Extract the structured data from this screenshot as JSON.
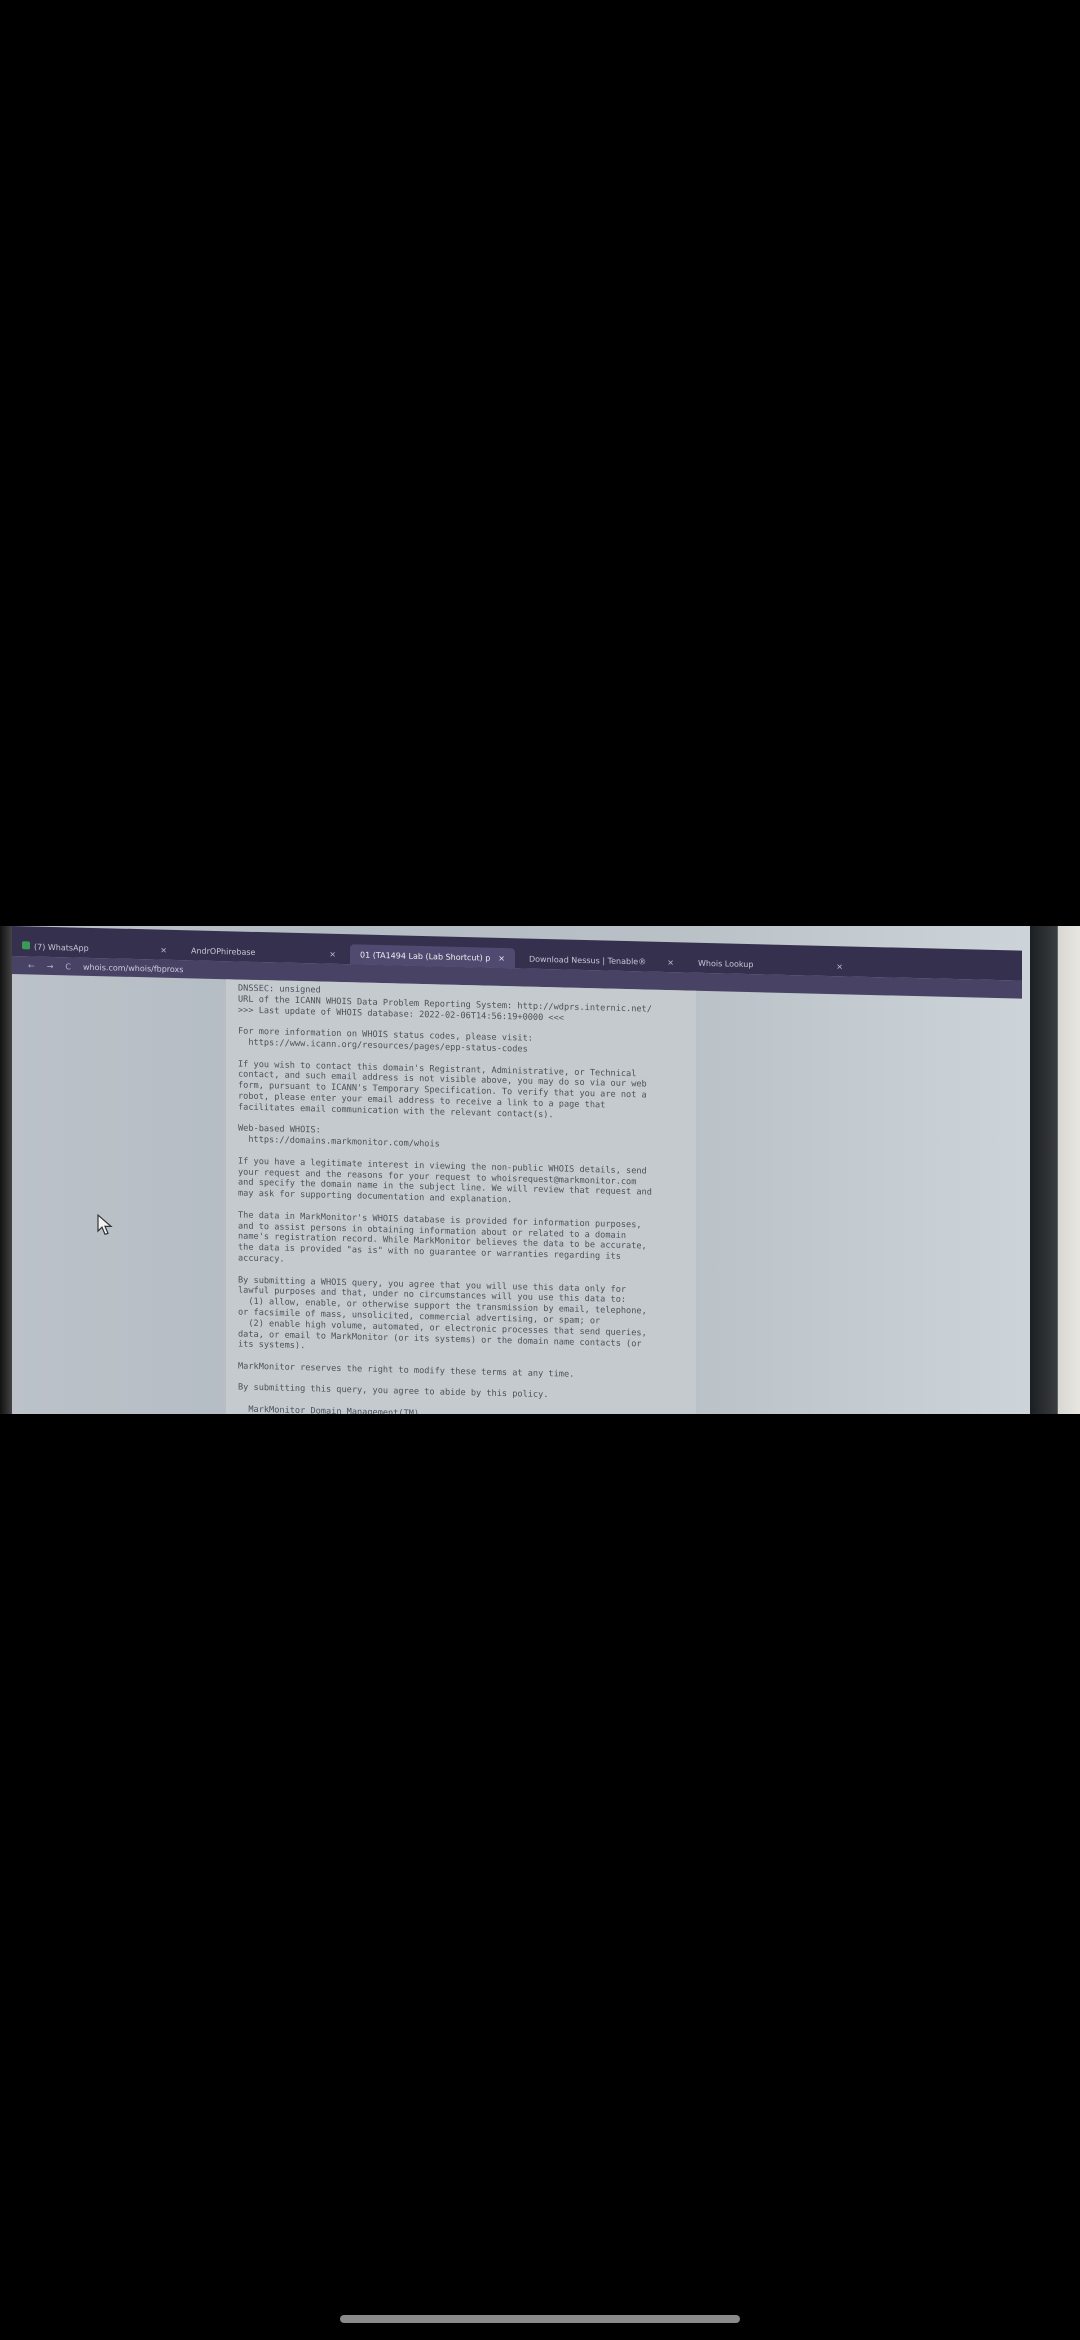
{
  "browser": {
    "tabs": [
      {
        "label": "(7) WhatsApp",
        "active": false
      },
      {
        "label": "AndrOPhirebase",
        "active": false
      },
      {
        "label": "01 (TA1494 Lab (Lab Shortcut) p",
        "active": true
      },
      {
        "label": "Download Nessus | Tenable®",
        "active": false
      },
      {
        "label": "Whois Lookup",
        "active": false
      }
    ],
    "close_glyph": "×",
    "nav": {
      "back": "←",
      "forward": "→",
      "reload": "C"
    },
    "url": "whois.com/whois/fbproxs"
  },
  "whois_text": "DNSSEC: unsigned\nURL of the ICANN WHOIS Data Problem Reporting System: http://wdprs.internic.net/\n>>> Last update of WHOIS database: 2022-02-06T14:56:19+0000 <<<\n\nFor more information on WHOIS status codes, please visit:\n  https://www.icann.org/resources/pages/epp-status-codes\n\nIf you wish to contact this domain's Registrant, Administrative, or Technical\ncontact, and such email address is not visible above, you may do so via our web\nform, pursuant to ICANN's Temporary Specification. To verify that you are not a\nrobot, please enter your email address to receive a link to a page that\nfacilitates email communication with the relevant contact(s).\n\nWeb-based WHOIS:\n  https://domains.markmonitor.com/whois\n\nIf you have a legitimate interest in viewing the non-public WHOIS details, send\nyour request and the reasons for your request to whoisrequest@markmonitor.com\nand specify the domain name in the subject line. We will review that request and\nmay ask for supporting documentation and explanation.\n\nThe data in MarkMonitor's WHOIS database is provided for information purposes,\nand to assist persons in obtaining information about or related to a domain\nname's registration record. While MarkMonitor believes the data to be accurate,\nthe data is provided \"as is\" with no guarantee or warranties regarding its\naccuracy.\n\nBy submitting a WHOIS query, you agree that you will use this data only for\nlawful purposes and that, under no circumstances will you use this data to:\n  (1) allow, enable, or otherwise support the transmission by email, telephone,\nor facsimile of mass, unsolicited, commercial advertising, or spam; or\n  (2) enable high volume, automated, or electronic processes that send queries,\ndata, or email to MarkMonitor (or its systems) or the domain name contacts (or\nits systems).\n\nMarkMonitor reserves the right to modify these terms at any time.\n\nBy submitting this query, you agree to abide by this policy.\n\n  MarkMonitor Domain Management(TM)",
  "icons": [
    "whatsapp-icon",
    "back-icon",
    "forward-icon",
    "reload-icon",
    "cursor-icon"
  ]
}
